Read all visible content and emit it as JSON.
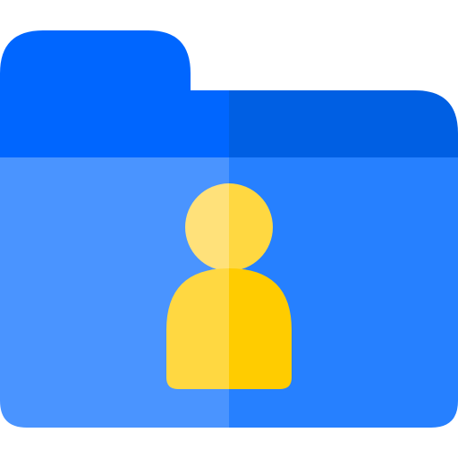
{
  "icon": {
    "name": "user-folder-icon",
    "colors": {
      "background": "#FFFFFF",
      "tab_left": "#0066FF",
      "tab_right": "#005FE3",
      "body_left": "#4A94FF",
      "body_right": "#2680FF",
      "head_left": "#FFE17A",
      "head_right": "#FFD841",
      "torso_left": "#FFD841",
      "torso_right": "#FFCC00"
    }
  }
}
